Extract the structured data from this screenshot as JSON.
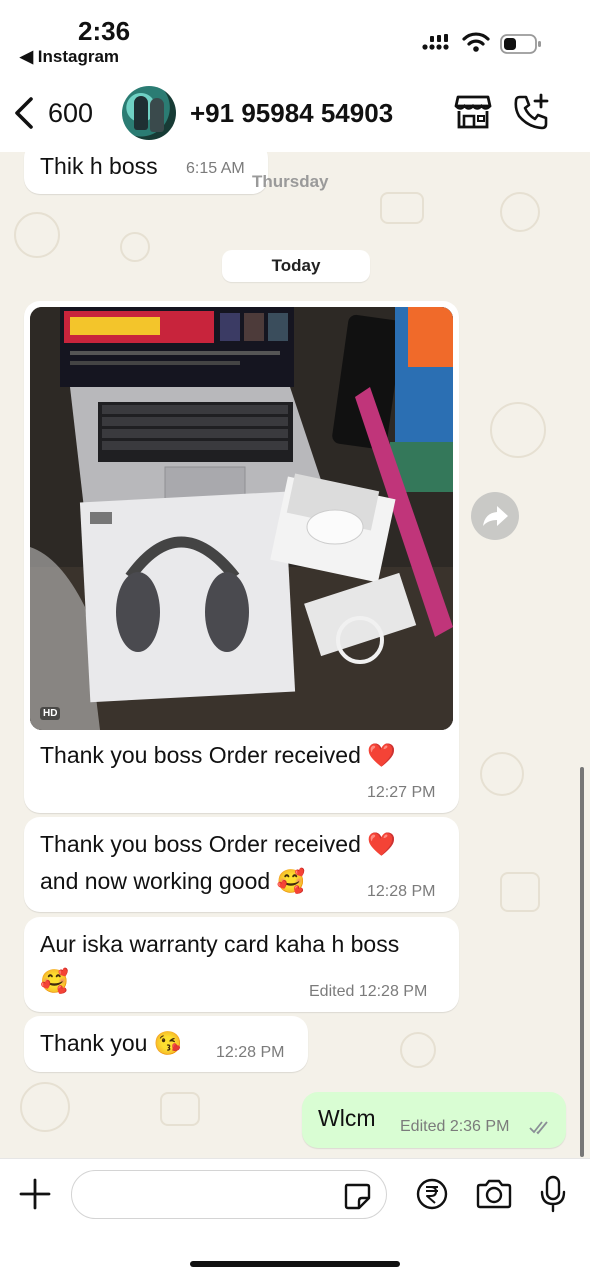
{
  "status_bar": {
    "time": "2:36",
    "back_app": "◀ Instagram"
  },
  "header": {
    "back_count": "600",
    "contact_name": "+91 95984 54903"
  },
  "messages": {
    "prev": {
      "text": "Thik h boss",
      "time": "6:15 AM"
    },
    "thursday_label": "Thursday",
    "today_label": "Today",
    "image_msg": {
      "hd_label": "HD",
      "caption": "Thank you boss Order received ❤️",
      "time": "12:27 PM"
    },
    "msg2": {
      "line1": "Thank you boss Order received ❤️",
      "line2": "and now working good 🥰",
      "time": "12:28 PM"
    },
    "msg3": {
      "line1": "Aur iska warranty card kaha h boss",
      "line2": "🥰",
      "meta": "Edited 12:28 PM"
    },
    "msg4": {
      "text": "Thank you 😘",
      "time": "12:28 PM"
    },
    "outgoing": {
      "text": "Wlcm",
      "meta": "Edited 2:36 PM"
    }
  },
  "icons": {
    "back": "chevron-left-icon",
    "store": "store-icon",
    "call": "add-call-icon",
    "forward": "forward-icon",
    "attach": "plus-icon",
    "sticker": "sticker-icon",
    "payment": "rupee-icon",
    "camera": "camera-icon",
    "mic": "mic-icon"
  },
  "colors": {
    "chat_background": "#f4f1e9",
    "outgoing_bubble": "#d9fdd3",
    "incoming_bubble": "#ffffff",
    "read_ticks": "#8a8f96"
  }
}
